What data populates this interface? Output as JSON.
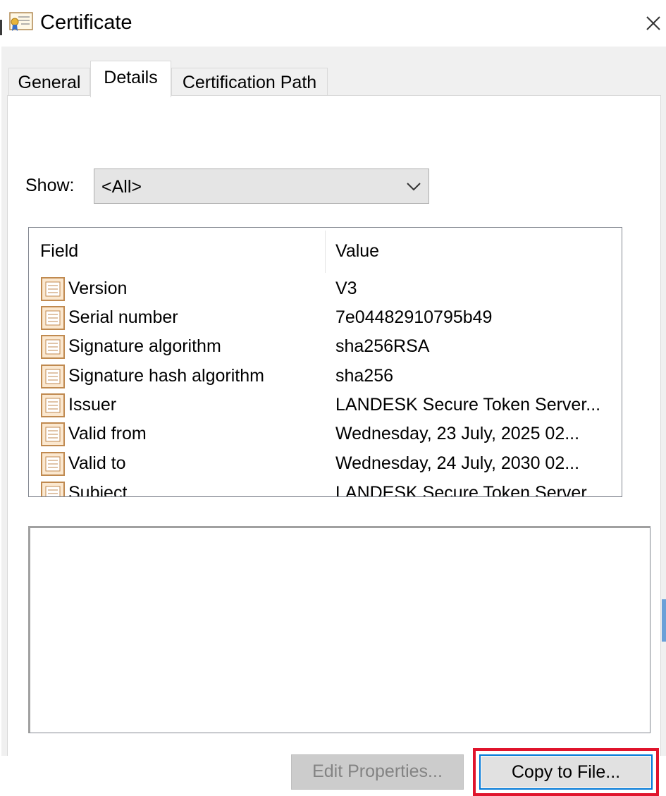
{
  "window": {
    "title": "Certificate",
    "title_icon": "certificate-icon",
    "close_icon": "close-icon"
  },
  "tabs": [
    {
      "label": "General",
      "active": false
    },
    {
      "label": "Details",
      "active": true
    },
    {
      "label": "Certification Path",
      "active": false
    }
  ],
  "show": {
    "label": "Show:",
    "selected": "<All>"
  },
  "list": {
    "columns": [
      "Field",
      "Value"
    ],
    "rows": [
      {
        "field": "Version",
        "value": "V3"
      },
      {
        "field": "Serial number",
        "value": "7e04482910795b49"
      },
      {
        "field": "Signature algorithm",
        "value": "sha256RSA"
      },
      {
        "field": "Signature hash algorithm",
        "value": "sha256"
      },
      {
        "field": "Issuer",
        "value": "LANDESK Secure Token Server..."
      },
      {
        "field": "Valid from",
        "value": "Wednesday, 23 July, 2025 02..."
      },
      {
        "field": "Valid to",
        "value": "Wednesday, 24 July, 2030 02..."
      },
      {
        "field": "Subject",
        "value": "LANDESK Secure Token Server"
      }
    ]
  },
  "buttons": {
    "edit_properties": "Edit Properties...",
    "copy_to_file": "Copy to File..."
  },
  "colors": {
    "highlight_outline": "#e0142c",
    "focus_border": "#0078d7"
  }
}
